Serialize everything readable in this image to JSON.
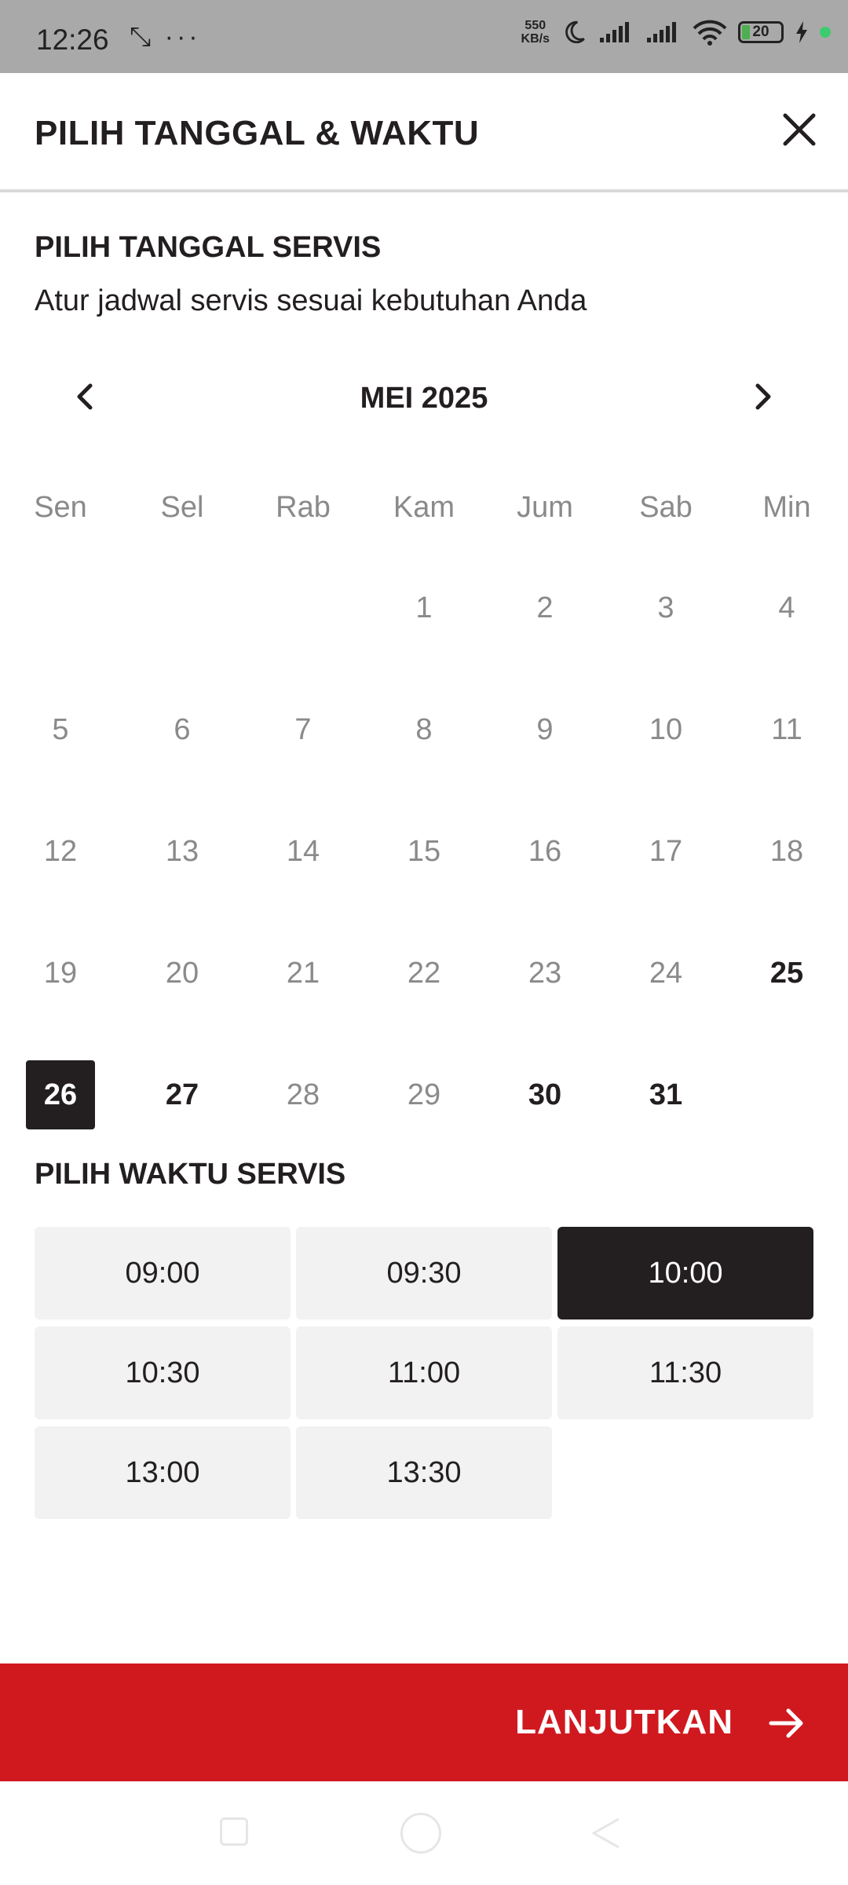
{
  "status_bar": {
    "time": "12:26",
    "left_icons": "⤡ ···",
    "speed_value": "550",
    "speed_unit": "KB/s",
    "battery": "20"
  },
  "header": {
    "title": "PILIH TANGGAL & WAKTU"
  },
  "date_section": {
    "title": "PILIH TANGGAL SERVIS",
    "subtitle": "Atur jadwal servis sesuai kebutuhan Anda"
  },
  "calendar": {
    "month_label": "MEI 2025",
    "weekdays": [
      "Sen",
      "Sel",
      "Rab",
      "Kam",
      "Jum",
      "Sab",
      "Min"
    ],
    "days": [
      {
        "label": "1",
        "state": "disabled"
      },
      {
        "label": "2",
        "state": "disabled"
      },
      {
        "label": "3",
        "state": "disabled"
      },
      {
        "label": "4",
        "state": "disabled"
      },
      {
        "label": "5",
        "state": "disabled"
      },
      {
        "label": "6",
        "state": "disabled"
      },
      {
        "label": "7",
        "state": "disabled"
      },
      {
        "label": "8",
        "state": "disabled"
      },
      {
        "label": "9",
        "state": "disabled"
      },
      {
        "label": "10",
        "state": "disabled"
      },
      {
        "label": "11",
        "state": "disabled"
      },
      {
        "label": "12",
        "state": "disabled"
      },
      {
        "label": "13",
        "state": "disabled"
      },
      {
        "label": "14",
        "state": "disabled"
      },
      {
        "label": "15",
        "state": "disabled"
      },
      {
        "label": "16",
        "state": "disabled"
      },
      {
        "label": "17",
        "state": "disabled"
      },
      {
        "label": "18",
        "state": "disabled"
      },
      {
        "label": "19",
        "state": "disabled"
      },
      {
        "label": "20",
        "state": "disabled"
      },
      {
        "label": "21",
        "state": "disabled"
      },
      {
        "label": "22",
        "state": "disabled"
      },
      {
        "label": "23",
        "state": "disabled"
      },
      {
        "label": "24",
        "state": "disabled"
      },
      {
        "label": "25",
        "state": "available"
      },
      {
        "label": "26",
        "state": "selected"
      },
      {
        "label": "27",
        "state": "available"
      },
      {
        "label": "28",
        "state": "disabled"
      },
      {
        "label": "29",
        "state": "disabled"
      },
      {
        "label": "30",
        "state": "available"
      },
      {
        "label": "31",
        "state": "available"
      }
    ]
  },
  "time_section": {
    "title": "PILIH WAKTU SERVIS",
    "slots": [
      {
        "label": "09:00",
        "selected": false
      },
      {
        "label": "09:30",
        "selected": false
      },
      {
        "label": "10:00",
        "selected": true
      },
      {
        "label": "10:30",
        "selected": false
      },
      {
        "label": "11:00",
        "selected": false
      },
      {
        "label": "11:30",
        "selected": false
      },
      {
        "label": "13:00",
        "selected": false
      },
      {
        "label": "13:30",
        "selected": false
      }
    ]
  },
  "cta": {
    "label": "LANJUTKAN"
  },
  "colors": {
    "accent": "#d0191f",
    "dark": "#231f20",
    "muted": "#8a8a8a",
    "slot_bg": "#f2f2f2"
  }
}
